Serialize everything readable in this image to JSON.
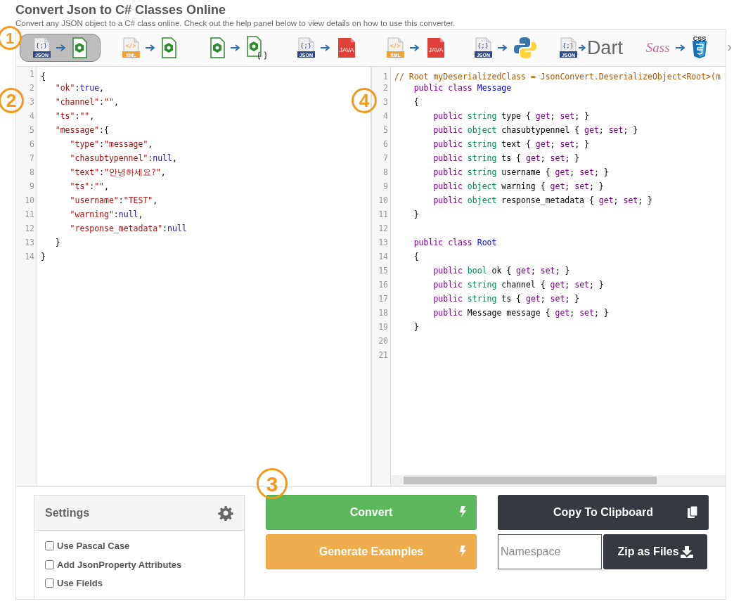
{
  "title": "Convert Json to C# Classes Online",
  "subtitle": "Convert any JSON object to a C# class online. Check out the help panel below to view details on how to use this converter.",
  "converters": [
    {
      "from": {
        "kind": "json",
        "glyph": "{;}",
        "label": "JSON"
      },
      "to": {
        "kind": "csharp"
      },
      "selected": true
    },
    {
      "from": {
        "kind": "xml",
        "glyph": "</>",
        "label": "XML"
      },
      "to": {
        "kind": "csharp"
      },
      "selected": false
    },
    {
      "from": {
        "kind": "csharp"
      },
      "to": {
        "kind": "csharp-braces"
      },
      "selected": false
    },
    {
      "from": {
        "kind": "json",
        "glyph": "{;}",
        "label": "JSON"
      },
      "to": {
        "kind": "java",
        "label": "JAVA"
      },
      "selected": false
    },
    {
      "from": {
        "kind": "xml",
        "glyph": "</>",
        "label": "XML"
      },
      "to": {
        "kind": "java",
        "label": "JAVA"
      },
      "selected": false
    },
    {
      "from": {
        "kind": "json",
        "glyph": "{;}",
        "label": "JSON"
      },
      "to": {
        "kind": "python"
      },
      "selected": false
    },
    {
      "from": {
        "kind": "json",
        "glyph": "{;}",
        "label": "JSON"
      },
      "to": {
        "kind": "dart",
        "label": "Dart"
      },
      "selected": false
    },
    {
      "from": {
        "kind": "sass",
        "label": "Sass"
      },
      "to": {
        "kind": "css",
        "label": "CSS"
      },
      "selected": false
    }
  ],
  "next_arrow": "›",
  "input_editor": {
    "lines": [
      {
        "number": "1",
        "tokens": [
          {
            "kind": "plain",
            "text": "{"
          }
        ]
      },
      {
        "number": "2",
        "tokens": [
          {
            "kind": "key",
            "text": "   \"ok\""
          },
          {
            "kind": "plain",
            "text": ":"
          },
          {
            "kind": "atom",
            "text": "true"
          },
          {
            "kind": "plain",
            "text": ","
          }
        ]
      },
      {
        "number": "3",
        "tokens": [
          {
            "kind": "key",
            "text": "   \"channel\""
          },
          {
            "kind": "plain",
            "text": ":"
          },
          {
            "kind": "string",
            "text": "\"\""
          },
          {
            "kind": "plain",
            "text": ","
          }
        ]
      },
      {
        "number": "4",
        "tokens": [
          {
            "kind": "key",
            "text": "   \"ts\""
          },
          {
            "kind": "plain",
            "text": ":"
          },
          {
            "kind": "string",
            "text": "\"\""
          },
          {
            "kind": "plain",
            "text": ","
          }
        ]
      },
      {
        "number": "5",
        "tokens": [
          {
            "kind": "key",
            "text": "   \"message\""
          },
          {
            "kind": "plain",
            "text": ":{"
          }
        ]
      },
      {
        "number": "6",
        "tokens": [
          {
            "kind": "key",
            "text": "      \"type\""
          },
          {
            "kind": "plain",
            "text": ":"
          },
          {
            "kind": "string",
            "text": "\"message\""
          },
          {
            "kind": "plain",
            "text": ","
          }
        ]
      },
      {
        "number": "7",
        "tokens": [
          {
            "kind": "key",
            "text": "      \"chasubtypennel\""
          },
          {
            "kind": "plain",
            "text": ":"
          },
          {
            "kind": "atom",
            "text": "null"
          },
          {
            "kind": "plain",
            "text": ","
          }
        ]
      },
      {
        "number": "8",
        "tokens": [
          {
            "kind": "key",
            "text": "      \"text\""
          },
          {
            "kind": "plain",
            "text": ":"
          },
          {
            "kind": "string",
            "text": "\"안녕하세요?\""
          },
          {
            "kind": "plain",
            "text": ","
          }
        ]
      },
      {
        "number": "9",
        "tokens": [
          {
            "kind": "key",
            "text": "      \"ts\""
          },
          {
            "kind": "plain",
            "text": ":"
          },
          {
            "kind": "string",
            "text": "\"\""
          },
          {
            "kind": "plain",
            "text": ","
          }
        ]
      },
      {
        "number": "10",
        "tokens": [
          {
            "kind": "key",
            "text": "      \"username\""
          },
          {
            "kind": "plain",
            "text": ":"
          },
          {
            "kind": "string",
            "text": "\"TEST\""
          },
          {
            "kind": "plain",
            "text": ","
          }
        ]
      },
      {
        "number": "11",
        "tokens": [
          {
            "kind": "key",
            "text": "      \"warning\""
          },
          {
            "kind": "plain",
            "text": ":"
          },
          {
            "kind": "atom",
            "text": "null"
          },
          {
            "kind": "plain",
            "text": ","
          }
        ]
      },
      {
        "number": "12",
        "tokens": [
          {
            "kind": "key",
            "text": "      \"response_metadata\""
          },
          {
            "kind": "plain",
            "text": ":"
          },
          {
            "kind": "atom",
            "text": "null"
          }
        ]
      },
      {
        "number": "13",
        "tokens": [
          {
            "kind": "plain",
            "text": "   }"
          }
        ]
      },
      {
        "number": "14",
        "tokens": [
          {
            "kind": "plain",
            "text": "}"
          }
        ]
      }
    ]
  },
  "output_editor": {
    "lines": [
      {
        "number": "1",
        "tokens": [
          {
            "kind": "comment",
            "text": "// Root myDeserializedClass = JsonConvert.DeserializeObject<Root>(m"
          }
        ]
      },
      {
        "number": "2",
        "tokens": [
          {
            "kind": "keyword",
            "text": "    public class "
          },
          {
            "kind": "classname",
            "text": "Message"
          }
        ]
      },
      {
        "number": "3",
        "tokens": [
          {
            "kind": "plain",
            "text": "    {"
          }
        ]
      },
      {
        "number": "4",
        "tokens": [
          {
            "kind": "keyword",
            "text": "        public "
          },
          {
            "kind": "type",
            "text": "string"
          },
          {
            "kind": "plain",
            "text": " type { "
          },
          {
            "kind": "accessor",
            "text": "get"
          },
          {
            "kind": "plain",
            "text": "; "
          },
          {
            "kind": "accessor",
            "text": "set"
          },
          {
            "kind": "plain",
            "text": "; }"
          }
        ]
      },
      {
        "number": "5",
        "tokens": [
          {
            "kind": "keyword",
            "text": "        public "
          },
          {
            "kind": "type",
            "text": "object"
          },
          {
            "kind": "plain",
            "text": " chasubtypennel { "
          },
          {
            "kind": "accessor",
            "text": "get"
          },
          {
            "kind": "plain",
            "text": "; "
          },
          {
            "kind": "accessor",
            "text": "set"
          },
          {
            "kind": "plain",
            "text": "; }"
          }
        ]
      },
      {
        "number": "6",
        "tokens": [
          {
            "kind": "keyword",
            "text": "        public "
          },
          {
            "kind": "type",
            "text": "string"
          },
          {
            "kind": "plain",
            "text": " text { "
          },
          {
            "kind": "accessor",
            "text": "get"
          },
          {
            "kind": "plain",
            "text": "; "
          },
          {
            "kind": "accessor",
            "text": "set"
          },
          {
            "kind": "plain",
            "text": "; }"
          }
        ]
      },
      {
        "number": "7",
        "tokens": [
          {
            "kind": "keyword",
            "text": "        public "
          },
          {
            "kind": "type",
            "text": "string"
          },
          {
            "kind": "plain",
            "text": " ts { "
          },
          {
            "kind": "accessor",
            "text": "get"
          },
          {
            "kind": "plain",
            "text": "; "
          },
          {
            "kind": "accessor",
            "text": "set"
          },
          {
            "kind": "plain",
            "text": "; }"
          }
        ]
      },
      {
        "number": "8",
        "tokens": [
          {
            "kind": "keyword",
            "text": "        public "
          },
          {
            "kind": "type",
            "text": "string"
          },
          {
            "kind": "plain",
            "text": " username { "
          },
          {
            "kind": "accessor",
            "text": "get"
          },
          {
            "kind": "plain",
            "text": "; "
          },
          {
            "kind": "accessor",
            "text": "set"
          },
          {
            "kind": "plain",
            "text": "; }"
          }
        ]
      },
      {
        "number": "9",
        "tokens": [
          {
            "kind": "keyword",
            "text": "        public "
          },
          {
            "kind": "type",
            "text": "object"
          },
          {
            "kind": "plain",
            "text": " warning { "
          },
          {
            "kind": "accessor",
            "text": "get"
          },
          {
            "kind": "plain",
            "text": "; "
          },
          {
            "kind": "accessor",
            "text": "set"
          },
          {
            "kind": "plain",
            "text": "; }"
          }
        ]
      },
      {
        "number": "10",
        "tokens": [
          {
            "kind": "keyword",
            "text": "        public "
          },
          {
            "kind": "type",
            "text": "object"
          },
          {
            "kind": "plain",
            "text": " response_metadata { "
          },
          {
            "kind": "accessor",
            "text": "get"
          },
          {
            "kind": "plain",
            "text": "; "
          },
          {
            "kind": "accessor",
            "text": "set"
          },
          {
            "kind": "plain",
            "text": "; }"
          }
        ]
      },
      {
        "number": "11",
        "tokens": [
          {
            "kind": "plain",
            "text": "    }"
          }
        ]
      },
      {
        "number": "12"
      },
      {
        "number": "13",
        "tokens": [
          {
            "kind": "keyword",
            "text": "    public class "
          },
          {
            "kind": "classname",
            "text": "Root"
          }
        ]
      },
      {
        "number": "14",
        "tokens": [
          {
            "kind": "plain",
            "text": "    {"
          }
        ]
      },
      {
        "number": "15",
        "tokens": [
          {
            "kind": "keyword",
            "text": "        public "
          },
          {
            "kind": "type",
            "text": "bool"
          },
          {
            "kind": "plain",
            "text": " ok { "
          },
          {
            "kind": "accessor",
            "text": "get"
          },
          {
            "kind": "plain",
            "text": "; "
          },
          {
            "kind": "accessor",
            "text": "set"
          },
          {
            "kind": "plain",
            "text": "; }"
          }
        ]
      },
      {
        "number": "16",
        "tokens": [
          {
            "kind": "keyword",
            "text": "        public "
          },
          {
            "kind": "type",
            "text": "string"
          },
          {
            "kind": "plain",
            "text": " channel { "
          },
          {
            "kind": "accessor",
            "text": "get"
          },
          {
            "kind": "plain",
            "text": "; "
          },
          {
            "kind": "accessor",
            "text": "set"
          },
          {
            "kind": "plain",
            "text": "; }"
          }
        ]
      },
      {
        "number": "17",
        "tokens": [
          {
            "kind": "keyword",
            "text": "        public "
          },
          {
            "kind": "type",
            "text": "string"
          },
          {
            "kind": "plain",
            "text": " ts { "
          },
          {
            "kind": "accessor",
            "text": "get"
          },
          {
            "kind": "plain",
            "text": "; "
          },
          {
            "kind": "accessor",
            "text": "set"
          },
          {
            "kind": "plain",
            "text": "; }"
          }
        ]
      },
      {
        "number": "18",
        "tokens": [
          {
            "kind": "keyword",
            "text": "        public "
          },
          {
            "kind": "plain",
            "text": "Message message { "
          },
          {
            "kind": "accessor",
            "text": "get"
          },
          {
            "kind": "plain",
            "text": "; "
          },
          {
            "kind": "accessor",
            "text": "set"
          },
          {
            "kind": "plain",
            "text": "; }"
          }
        ]
      },
      {
        "number": "19",
        "tokens": [
          {
            "kind": "plain",
            "text": "    }"
          }
        ]
      },
      {
        "number": "20"
      },
      {
        "number": "21"
      }
    ]
  },
  "settings": {
    "title": "Settings",
    "options": [
      {
        "label": "Use Pascal Case",
        "checked": false
      },
      {
        "label": "Add JsonProperty Attributes",
        "checked": false
      },
      {
        "label": "Use Fields",
        "checked": false
      }
    ]
  },
  "buttons": {
    "convert": "Convert",
    "generate": "Generate Examples",
    "copy": "Copy To Clipboard",
    "zip": "Zip as Files"
  },
  "namespace": {
    "placeholder": "Namespace"
  },
  "markers": [
    "1",
    "2",
    "3",
    "4"
  ]
}
